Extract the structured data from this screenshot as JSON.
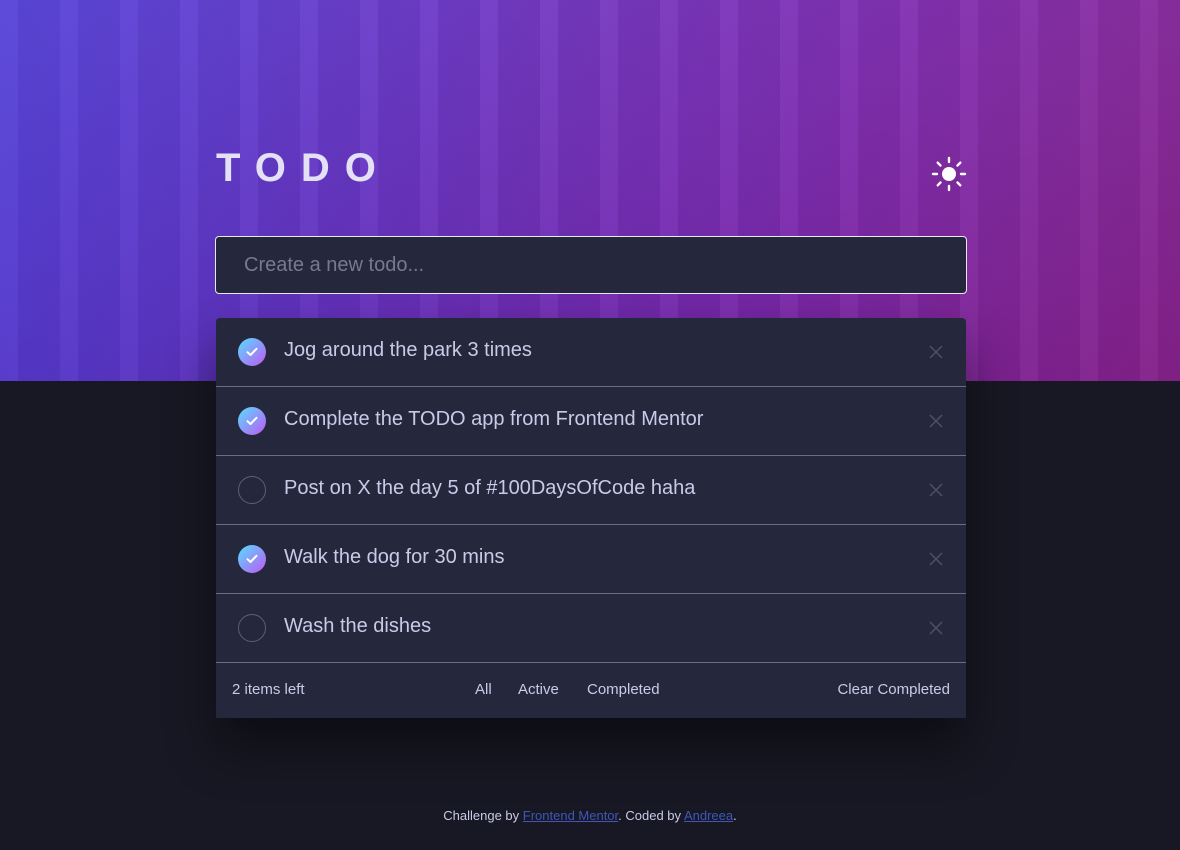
{
  "header": {
    "title": "TODO",
    "theme_toggle_icon": "sun-icon"
  },
  "new_todo": {
    "placeholder": "Create a new todo...",
    "value": ""
  },
  "todos": [
    {
      "text": "Jog around the park 3 times",
      "completed": true
    },
    {
      "text": "Complete the TODO app from Frontend Mentor",
      "completed": true
    },
    {
      "text": "Post on X the day 5 of #100DaysOfCode haha",
      "completed": false
    },
    {
      "text": "Walk the dog for 30 mins",
      "completed": true
    },
    {
      "text": "Wash the dishes",
      "completed": false
    }
  ],
  "footer": {
    "items_left": "2 items left",
    "filters": {
      "all": "All",
      "active": "Active",
      "completed": "Completed"
    },
    "active_filter": "All",
    "clear": "Clear Completed"
  },
  "attribution": {
    "prefix": "Challenge by ",
    "link1": "Frontend Mentor",
    "middle": ". Coded by ",
    "link2": "Andreea",
    "suffix": "."
  },
  "colors": {
    "background": "#171823",
    "card": "#25273d",
    "text": "#c8cbe7",
    "check_gradient_start": "#55ddff",
    "check_gradient_end": "#c058f3",
    "link": "#3f57b8"
  }
}
